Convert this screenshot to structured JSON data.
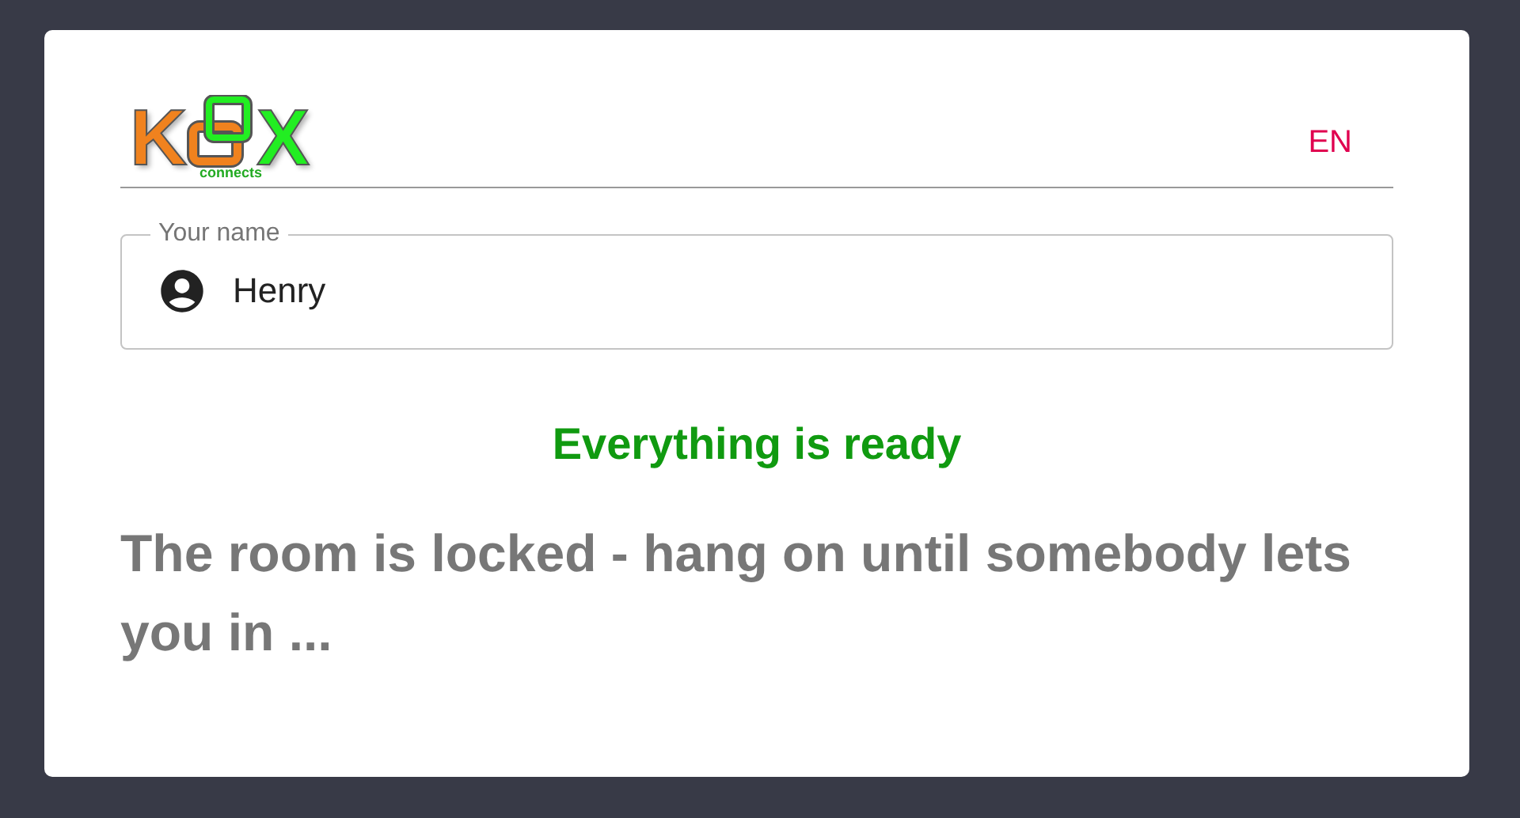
{
  "logo": {
    "letters": [
      {
        "text": "K",
        "color": "#f0821e"
      },
      {
        "text": "X",
        "color": "#22ee22"
      }
    ],
    "tagline": "connects"
  },
  "language": {
    "label": "EN"
  },
  "name_field": {
    "label": "Your name",
    "value": "Henry"
  },
  "status": "Everything is ready",
  "message": "The room is locked - hang on until somebody lets you in ..."
}
